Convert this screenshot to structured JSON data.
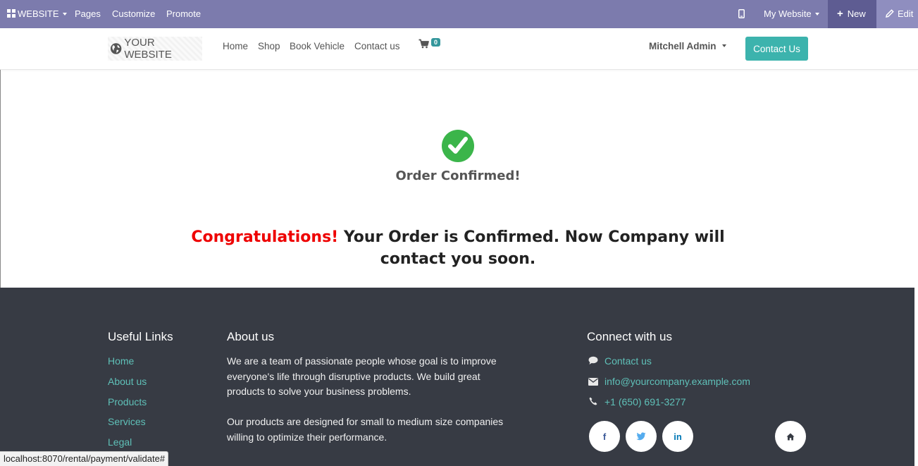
{
  "adminbar": {
    "website_label": "WEBSITE",
    "pages_label": "Pages",
    "customize_label": "Customize",
    "promote_label": "Promote",
    "my_website_label": "My Website",
    "new_label": "New",
    "edit_label": "Edit"
  },
  "header": {
    "logo_text": "YOUR WEBSITE",
    "nav": [
      "Home",
      "Shop",
      "Book Vehicle",
      "Contact us"
    ],
    "cart_count": "0",
    "user_name": "Mitchell Admin",
    "contact_button": "Contact Us"
  },
  "main": {
    "status_title": "Order Confirmed!",
    "congrats_highlight": "Congratulations!",
    "congrats_rest": " Your Order is Confirmed. Now Company will contact you soon."
  },
  "footer": {
    "useful_links": {
      "title": "Useful Links",
      "items": [
        "Home",
        "About us",
        "Products",
        "Services",
        "Legal"
      ]
    },
    "about": {
      "title": "About us",
      "para1": "We are a team of passionate people whose goal is to improve everyone's life through disruptive products. We build great products to solve your business problems.",
      "para2": "Our products are designed for small to medium size companies willing to optimize their performance."
    },
    "connect": {
      "title": "Connect with us",
      "contact": "Contact us",
      "email": "info@yourcompany.example.com",
      "phone": "+1 (650) 691-3277"
    },
    "social": {
      "facebook": "f",
      "linkedin": "in"
    }
  },
  "status_url": "localhost:8070/rental/payment/validate#",
  "colors": {
    "adminbar": "#7c7bad",
    "accent": "#3cb3ad",
    "footer_bg": "#373b44",
    "link": "#5fc0b8",
    "congrats_red": "#ee0000",
    "check_green": "#3bb54a"
  }
}
